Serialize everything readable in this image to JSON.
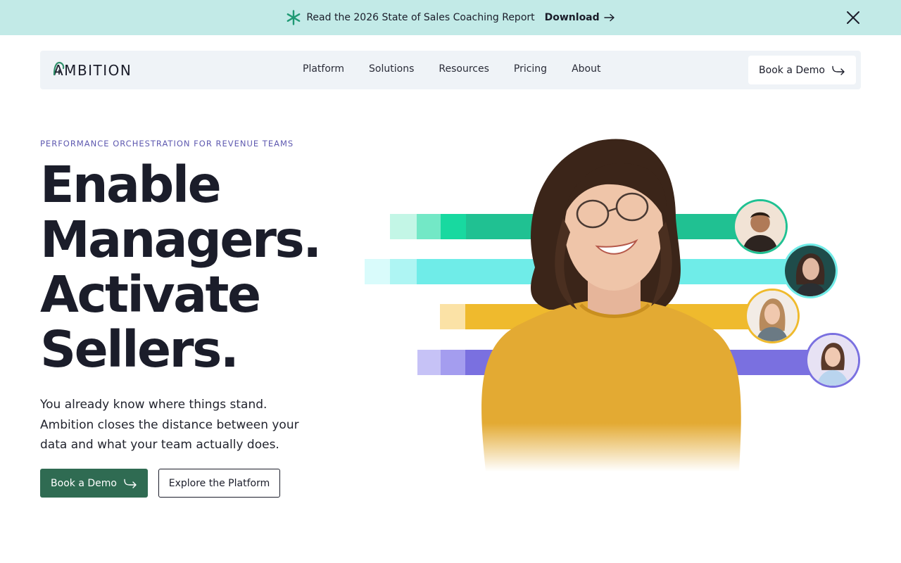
{
  "announcement": {
    "text": "Read the 2026 State of Sales Coaching Report",
    "link_label": "Download"
  },
  "nav": {
    "logo_text": "AMBITION",
    "links": [
      "Platform",
      "Solutions",
      "Resources",
      "Pricing",
      "About"
    ],
    "cta_label": "Book a Demo"
  },
  "hero": {
    "eyebrow": "PERFORMANCE ORCHESTRATION FOR REVENUE TEAMS",
    "headline_lines": [
      "Enable",
      "Managers.",
      "Activate",
      "Sellers."
    ],
    "subheadline_lines": [
      "You already know where things stand.",
      "Ambition closes the distance between your",
      "data and what your team actually does."
    ],
    "primary_cta": "Book a Demo",
    "secondary_cta": "Explore the Platform"
  },
  "colors": {
    "announcement_bg": "#c2eae7",
    "nav_bg": "#eff3f7",
    "primary_button": "#2f6b52",
    "eyebrow": "#5f5ab0",
    "bar_green": "#20c192",
    "bar_cyan": "#6fece8",
    "bar_yellow": "#efba2d",
    "bar_purple": "#7a70e0"
  },
  "icons": {
    "announcement": "asterisk-icon",
    "download": "arrow-right-icon",
    "close": "close-icon",
    "cta": "arrow-curve-right-icon"
  }
}
